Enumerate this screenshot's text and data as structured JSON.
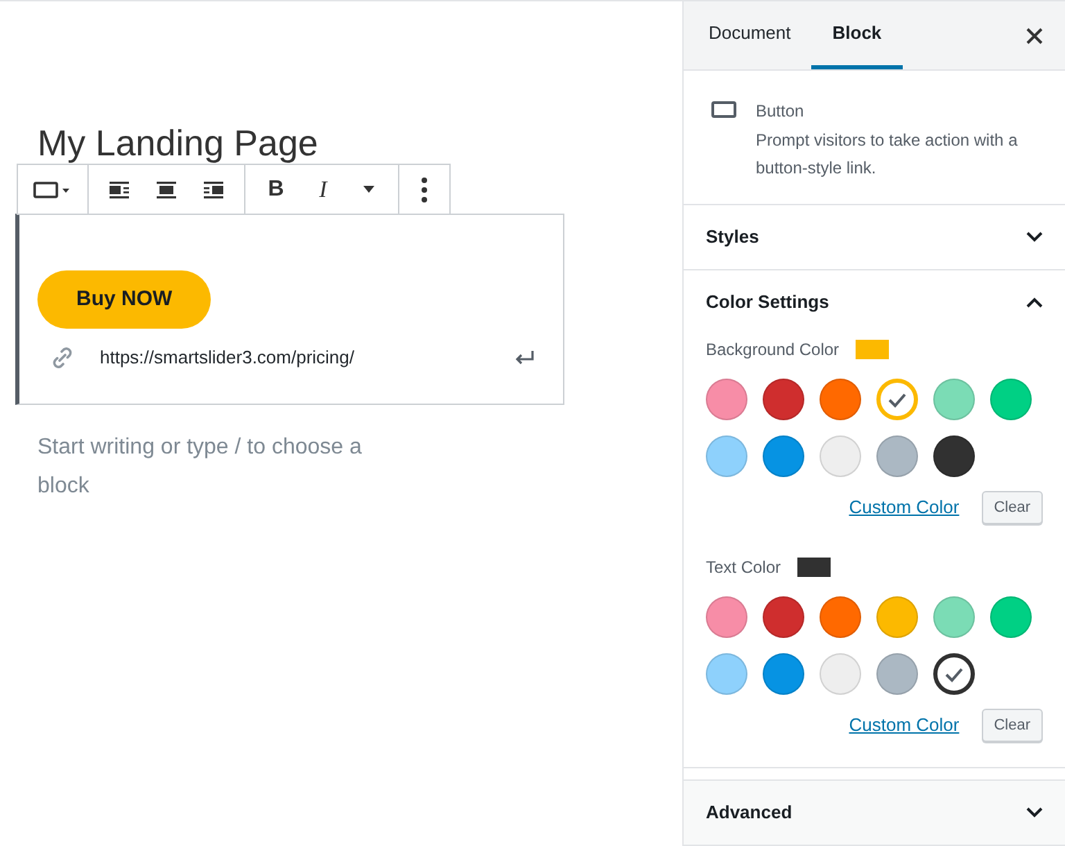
{
  "editor": {
    "title": "My Landing Page",
    "toolbar": {
      "bold": "B",
      "italic": "I"
    },
    "button_block": {
      "label": "Buy NOW",
      "url": "https://smartslider3.com/pricing/"
    },
    "placeholder": "Start writing or type / to choose a block"
  },
  "sidebar": {
    "tabs": [
      {
        "label": "Document",
        "selected": false
      },
      {
        "label": "Block",
        "selected": true
      }
    ],
    "block_card": {
      "title": "Button",
      "description": "Prompt visitors to take action with a button-style link."
    },
    "panels": [
      {
        "title": "Styles",
        "expanded": false
      },
      {
        "title": "Color Settings",
        "expanded": true,
        "groups": [
          {
            "label": "Background Color",
            "color": "#fcb900",
            "custom_link": "Custom Color",
            "clear": "Clear",
            "swatches": [
              {
                "color": "#f78da7",
                "selected": false
              },
              {
                "color": "#cf2e2e",
                "selected": false
              },
              {
                "color": "#ff6900",
                "selected": false
              },
              {
                "color": "#fcb900",
                "selected": true
              },
              {
                "color": "#7bdcb5",
                "selected": false
              },
              {
                "color": "#00d084",
                "selected": false
              },
              {
                "color": "#8ed1fc",
                "selected": false
              },
              {
                "color": "#0693e3",
                "selected": false
              },
              {
                "color": "#eeeeee",
                "selected": false
              },
              {
                "color": "#abb8c3",
                "selected": false
              },
              {
                "color": "#313131",
                "selected": false
              }
            ]
          },
          {
            "label": "Text Color",
            "color": "#313131",
            "custom_link": "Custom Color",
            "clear": "Clear",
            "swatches": [
              {
                "color": "#f78da7",
                "selected": false
              },
              {
                "color": "#cf2e2e",
                "selected": false
              },
              {
                "color": "#ff6900",
                "selected": false
              },
              {
                "color": "#fcb900",
                "selected": false
              },
              {
                "color": "#7bdcb5",
                "selected": false
              },
              {
                "color": "#00d084",
                "selected": false
              },
              {
                "color": "#8ed1fc",
                "selected": false
              },
              {
                "color": "#0693e3",
                "selected": false
              },
              {
                "color": "#eeeeee",
                "selected": false
              },
              {
                "color": "#abb8c3",
                "selected": false
              },
              {
                "color": "#313131",
                "selected": true
              }
            ]
          }
        ]
      },
      {
        "title": "Advanced",
        "expanded": false
      }
    ]
  }
}
